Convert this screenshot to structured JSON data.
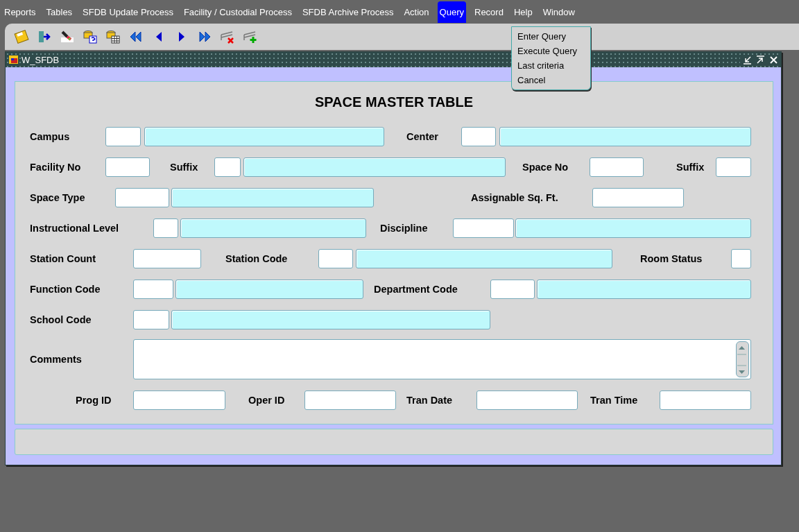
{
  "menu_bar": [
    {
      "label": "Reports",
      "selected": false
    },
    {
      "label": "Tables",
      "selected": false
    },
    {
      "label": "SFDB Update Process",
      "selected": false
    },
    {
      "label": "Facility / Custodial Process",
      "selected": false
    },
    {
      "label": "SFDB Archive Process",
      "selected": false
    },
    {
      "label": "Action",
      "selected": false
    },
    {
      "label": "Query",
      "selected": true
    },
    {
      "label": "Record",
      "selected": false
    },
    {
      "label": "Help",
      "selected": false
    },
    {
      "label": "Window",
      "selected": false
    }
  ],
  "query_menu": [
    "Enter Query",
    "Execute Query",
    "Last criteria",
    "Cancel"
  ],
  "toolbar": [
    {
      "kind": "save"
    },
    {
      "kind": "exit"
    },
    {
      "kind": "clear"
    },
    {
      "kind": "query"
    },
    {
      "kind": "table"
    },
    {
      "kind": "first"
    },
    {
      "kind": "previous"
    },
    {
      "kind": "next"
    },
    {
      "kind": "last"
    },
    {
      "kind": "delete"
    },
    {
      "kind": "insert"
    }
  ],
  "window": {
    "title": "W_SFDB"
  },
  "form": {
    "title": "SPACE MASTER TABLE",
    "lines": [
      {
        "items": [
          {
            "kind": "label",
            "text": "Campus"
          },
          {
            "kind": "code"
          },
          {
            "kind": "desc"
          },
          {
            "kind": "label",
            "text": "Center"
          },
          {
            "kind": "code"
          },
          {
            "kind": "desc"
          }
        ]
      },
      {
        "items": [
          {
            "kind": "label",
            "text": "Facility No"
          },
          {
            "kind": "code"
          },
          {
            "kind": "label",
            "text": "Suffix"
          },
          {
            "kind": "code"
          },
          {
            "kind": "desc"
          },
          {
            "kind": "label",
            "text": "Space No"
          },
          {
            "kind": "code"
          },
          {
            "kind": "label",
            "text": "Suffix"
          },
          {
            "kind": "code"
          }
        ]
      },
      {
        "items": [
          {
            "kind": "label",
            "text": "Space Type"
          },
          {
            "kind": "code"
          },
          {
            "kind": "desc"
          },
          {
            "kind": "label",
            "text": "Assignable Sq. Ft."
          },
          {
            "kind": "code"
          }
        ]
      },
      {
        "items": [
          {
            "kind": "label",
            "text": "Instructional Level"
          },
          {
            "kind": "code"
          },
          {
            "kind": "desc"
          },
          {
            "kind": "label",
            "text": "Discipline"
          },
          {
            "kind": "code"
          },
          {
            "kind": "desc"
          }
        ]
      },
      {
        "items": [
          {
            "kind": "label",
            "text": "Station Count"
          },
          {
            "kind": "code"
          },
          {
            "kind": "label",
            "text": "Station Code"
          },
          {
            "kind": "code"
          },
          {
            "kind": "desc"
          },
          {
            "kind": "label",
            "text": "Room Status"
          },
          {
            "kind": "code"
          }
        ]
      },
      {
        "items": [
          {
            "kind": "label",
            "text": "Function Code"
          },
          {
            "kind": "code"
          },
          {
            "kind": "desc"
          },
          {
            "kind": "label",
            "text": "Department Code"
          },
          {
            "kind": "code"
          },
          {
            "kind": "desc"
          }
        ]
      },
      {
        "items": [
          {
            "kind": "label",
            "text": "School Code"
          },
          {
            "kind": "code"
          },
          {
            "kind": "desc"
          }
        ]
      },
      {
        "items": [
          {
            "kind": "label",
            "text": "Comments"
          },
          {
            "kind": "memo"
          }
        ]
      },
      {
        "items": [
          {
            "kind": "label",
            "text": "Prog ID"
          },
          {
            "kind": "code"
          },
          {
            "kind": "label",
            "text": "Oper ID"
          },
          {
            "kind": "code"
          },
          {
            "kind": "label",
            "text": "Tran Date"
          },
          {
            "kind": "code"
          },
          {
            "kind": "label",
            "text": "Tran Time"
          },
          {
            "kind": "code"
          }
        ]
      }
    ]
  }
}
